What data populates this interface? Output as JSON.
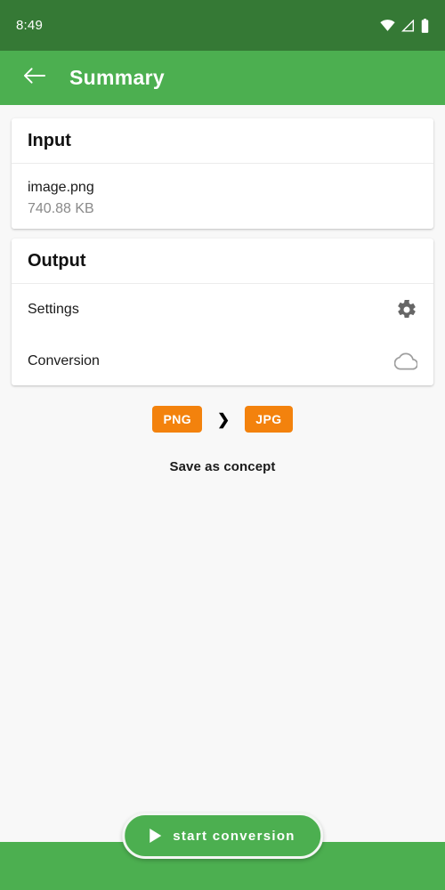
{
  "status_bar": {
    "time": "8:49",
    "icons": [
      "wifi-icon",
      "cellular-signal-icon",
      "battery-icon"
    ]
  },
  "app_bar": {
    "back_icon": "arrow-back-icon",
    "title": "Summary"
  },
  "input_card": {
    "header": "Input",
    "file_name": "image.png",
    "file_size": "740.88 KB"
  },
  "output_card": {
    "header": "Output",
    "rows": [
      {
        "label": "Settings",
        "icon": "gear-icon"
      },
      {
        "label": "Conversion",
        "icon": "cloud-icon"
      }
    ]
  },
  "conversion": {
    "from_format": "PNG",
    "to_format": "JPG",
    "arrow_icon": "chevron-right-icon",
    "chip_color": "#f3820d",
    "save_as_concept": "Save as concept"
  },
  "action_button": {
    "label": "start conversion",
    "icon": "play-icon",
    "color": "#4caf50"
  },
  "theme": {
    "status_bar_color": "#357935",
    "app_bar_color": "#4caf50",
    "background": "#f8f8f8",
    "card_background": "#ffffff"
  }
}
